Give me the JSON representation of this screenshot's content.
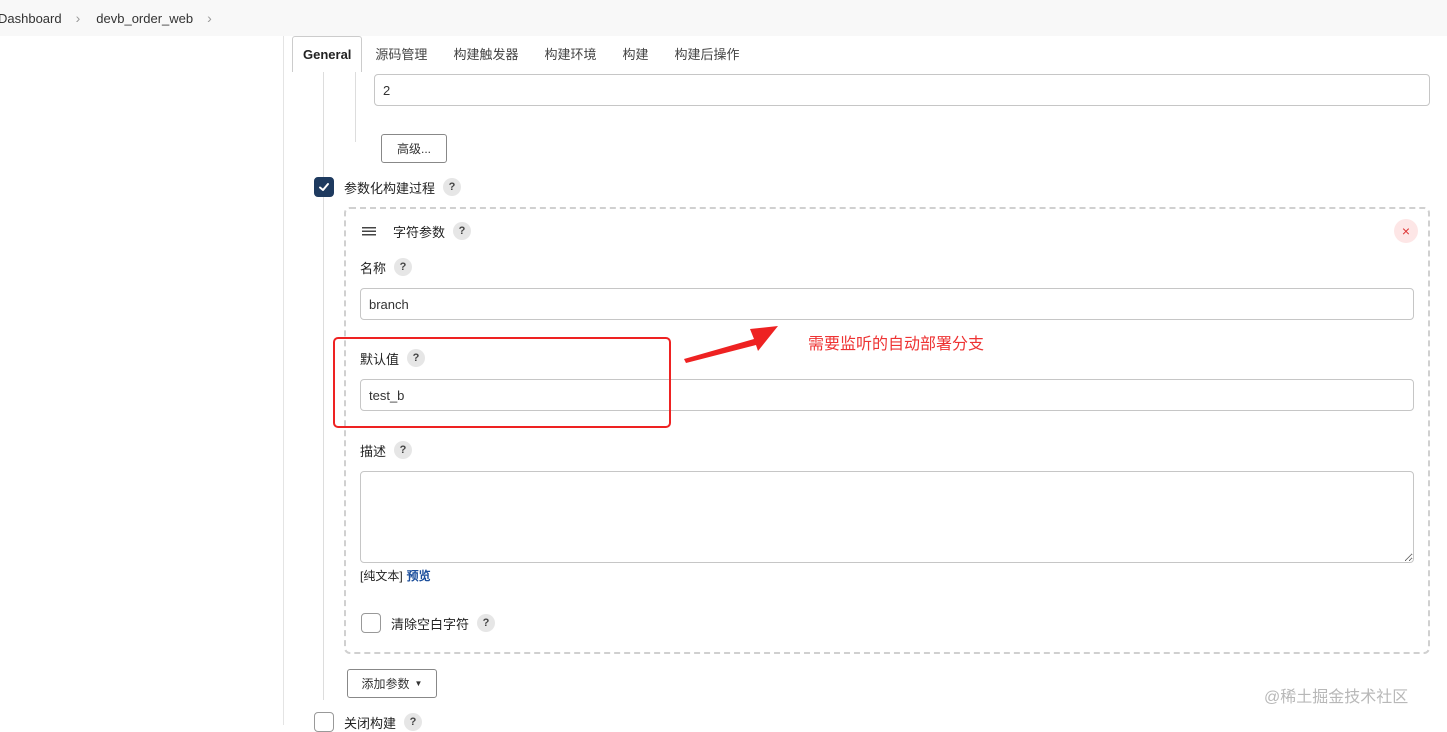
{
  "breadcrumb": {
    "items": [
      "Dashboard",
      "devb_order_web"
    ]
  },
  "tabs": [
    {
      "label": "General",
      "active": true
    },
    {
      "label": "源码管理"
    },
    {
      "label": "构建触发器"
    },
    {
      "label": "构建环境"
    },
    {
      "label": "构建"
    },
    {
      "label": "构建后操作"
    }
  ],
  "top_field": {
    "value": "2"
  },
  "advanced_button": {
    "label": "高级..."
  },
  "parameterized": {
    "label": "参数化构建过程",
    "checked": true,
    "help": "?"
  },
  "param": {
    "type_label": "字符参数",
    "help": "?",
    "close": "×",
    "name_label": "名称",
    "name_value": "branch",
    "default_label": "默认值",
    "default_value": "test_b",
    "desc_label": "描述",
    "desc_value": "",
    "format_prefix": "[纯文本]",
    "preview_link": "预览",
    "trim_label": "清除空白字符",
    "trim_checked": false
  },
  "add_param_button": {
    "label": "添加参数"
  },
  "disable_build": {
    "label": "关闭构建",
    "help": "?"
  },
  "annotation": {
    "text": "需要监听的自动部署分支"
  },
  "watermark": {
    "text": "@稀土掘金技术社区"
  },
  "colors": {
    "accent": "#1e3a5f",
    "annotation": "#ee3333",
    "link": "#1c4f9c"
  }
}
